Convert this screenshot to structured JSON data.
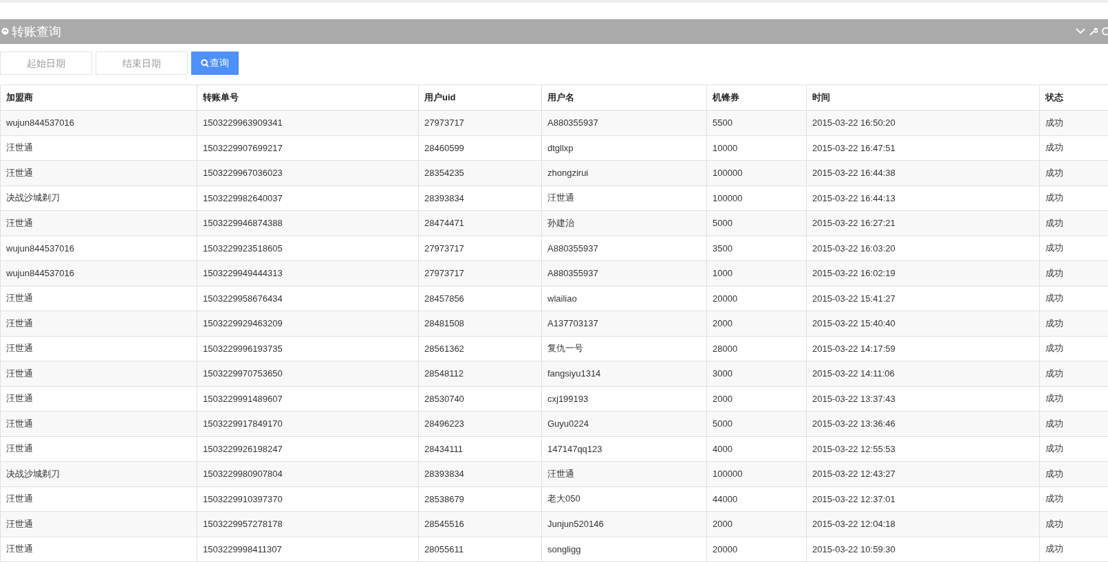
{
  "panel": {
    "title": "转账查询",
    "tools": [
      {
        "kind": "collapse"
      },
      {
        "kind": "settings"
      },
      {
        "kind": "refresh"
      }
    ]
  },
  "filters": {
    "start_date": {
      "placeholder": "起始日期"
    },
    "end_date": {
      "placeholder": "结束日期"
    },
    "search_button": "查询"
  },
  "table": {
    "columns": [
      "加盟商",
      "转账单号",
      "用户uid",
      "用户名",
      "机锋券",
      "时间",
      "状态"
    ],
    "rows": [
      [
        "wujun844537016",
        "1503229963909341",
        "27973717",
        "A880355937",
        "5500",
        "2015-03-22 16:50:20",
        "成功"
      ],
      [
        "汪世通",
        "1503229907699217",
        "28460599",
        "dtgllxp",
        "10000",
        "2015-03-22 16:47:51",
        "成功"
      ],
      [
        "汪世通",
        "1503229967036023",
        "28354235",
        "zhongzirui",
        "100000",
        "2015-03-22 16:44:38",
        "成功"
      ],
      [
        "决战沙城剃刀",
        "1503229982640037",
        "28393834",
        "汪世通",
        "100000",
        "2015-03-22 16:44:13",
        "成功"
      ],
      [
        "汪世通",
        "1503229946874388",
        "28474471",
        "孙建治",
        "5000",
        "2015-03-22 16:27:21",
        "成功"
      ],
      [
        "wujun844537016",
        "1503229923518605",
        "27973717",
        "A880355937",
        "3500",
        "2015-03-22 16:03:20",
        "成功"
      ],
      [
        "wujun844537016",
        "1503229949444313",
        "27973717",
        "A880355937",
        "1000",
        "2015-03-22 16:02:19",
        "成功"
      ],
      [
        "汪世通",
        "1503229958676434",
        "28457856",
        "wlailiao",
        "20000",
        "2015-03-22 15:41:27",
        "成功"
      ],
      [
        "汪世通",
        "1503229929463209",
        "28481508",
        "A137703137",
        "2000",
        "2015-03-22 15:40:40",
        "成功"
      ],
      [
        "汪世通",
        "1503229996193735",
        "28561362",
        "复仇一号",
        "28000",
        "2015-03-22 14:17:59",
        "成功"
      ],
      [
        "汪世通",
        "1503229970753650",
        "28548112",
        "fangsiyu1314",
        "3000",
        "2015-03-22 14:11:06",
        "成功"
      ],
      [
        "汪世通",
        "1503229991489607",
        "28530740",
        "cxj199193",
        "2000",
        "2015-03-22 13:37:43",
        "成功"
      ],
      [
        "汪世通",
        "1503229917849170",
        "28496223",
        "Guyu0224",
        "5000",
        "2015-03-22 13:36:46",
        "成功"
      ],
      [
        "汪世通",
        "1503229926198247",
        "28434111",
        "147147qq123",
        "4000",
        "2015-03-22 12:55:53",
        "成功"
      ],
      [
        "决战沙城剃刀",
        "1503229980907804",
        "28393834",
        "汪世通",
        "100000",
        "2015-03-22 12:43:27",
        "成功"
      ],
      [
        "汪世通",
        "1503229910397370",
        "28538679",
        "老大050",
        "44000",
        "2015-03-22 12:37:01",
        "成功"
      ],
      [
        "汪世通",
        "1503229957278178",
        "28545516",
        "Junjun520146",
        "2000",
        "2015-03-22 12:04:18",
        "成功"
      ],
      [
        "汪世通",
        "1503229998411307",
        "28055611",
        "songligg",
        "20000",
        "2015-03-22 10:59:30",
        "成功"
      ]
    ]
  }
}
